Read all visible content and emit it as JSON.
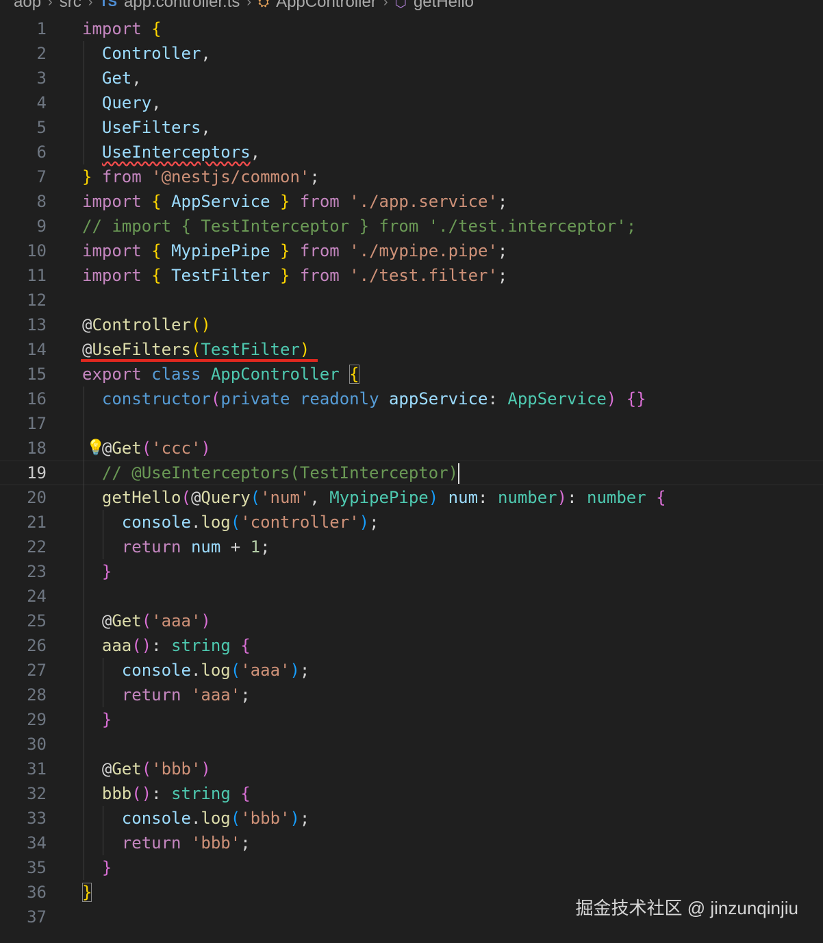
{
  "breadcrumb": {
    "items": [
      "aop",
      "src",
      "app.controller.ts",
      "AppController",
      "getHello"
    ],
    "ts_icon_label": "TS"
  },
  "editor": {
    "current_line": 19,
    "lines": [
      {
        "n": "1",
        "tokens": [
          [
            "import",
            "kw"
          ],
          [
            " ",
            "def"
          ],
          [
            "{",
            "b1"
          ]
        ]
      },
      {
        "n": "2",
        "tokens": [
          [
            "  Controller",
            "var"
          ],
          [
            ",",
            "def"
          ]
        ]
      },
      {
        "n": "3",
        "tokens": [
          [
            "  Get",
            "var"
          ],
          [
            ",",
            "def"
          ]
        ]
      },
      {
        "n": "4",
        "tokens": [
          [
            "  Query",
            "var"
          ],
          [
            ",",
            "def"
          ]
        ]
      },
      {
        "n": "5",
        "tokens": [
          [
            "  UseFilters",
            "var"
          ],
          [
            ",",
            "def"
          ]
        ]
      },
      {
        "n": "6",
        "tokens": [
          [
            "  ",
            "def"
          ],
          [
            "UseInterceptors",
            "var-squiggle"
          ],
          [
            ",",
            "def"
          ]
        ]
      },
      {
        "n": "7",
        "tokens": [
          [
            "}",
            "b1"
          ],
          [
            " ",
            "def"
          ],
          [
            "from",
            "kw"
          ],
          [
            " ",
            "def"
          ],
          [
            "'@nestjs/common'",
            "str"
          ],
          [
            ";",
            "def"
          ]
        ]
      },
      {
        "n": "8",
        "tokens": [
          [
            "import",
            "kw"
          ],
          [
            " ",
            "def"
          ],
          [
            "{",
            "b1"
          ],
          [
            " ",
            "def"
          ],
          [
            "AppService",
            "var"
          ],
          [
            " ",
            "def"
          ],
          [
            "}",
            "b1"
          ],
          [
            " ",
            "def"
          ],
          [
            "from",
            "kw"
          ],
          [
            " ",
            "def"
          ],
          [
            "'./app.service'",
            "str"
          ],
          [
            ";",
            "def"
          ]
        ]
      },
      {
        "n": "9",
        "tokens": [
          [
            "// import { TestInterceptor } from './test.interceptor';",
            "cmt"
          ]
        ]
      },
      {
        "n": "10",
        "tokens": [
          [
            "import",
            "kw"
          ],
          [
            " ",
            "def"
          ],
          [
            "{",
            "b1"
          ],
          [
            " ",
            "def"
          ],
          [
            "MypipePipe",
            "var"
          ],
          [
            " ",
            "def"
          ],
          [
            "}",
            "b1"
          ],
          [
            " ",
            "def"
          ],
          [
            "from",
            "kw"
          ],
          [
            " ",
            "def"
          ],
          [
            "'./mypipe.pipe'",
            "str"
          ],
          [
            ";",
            "def"
          ]
        ]
      },
      {
        "n": "11",
        "tokens": [
          [
            "import",
            "kw"
          ],
          [
            " ",
            "def"
          ],
          [
            "{",
            "b1"
          ],
          [
            " ",
            "def"
          ],
          [
            "TestFilter",
            "var"
          ],
          [
            " ",
            "def"
          ],
          [
            "}",
            "b1"
          ],
          [
            " ",
            "def"
          ],
          [
            "from",
            "kw"
          ],
          [
            " ",
            "def"
          ],
          [
            "'./test.filter'",
            "str"
          ],
          [
            ";",
            "def"
          ]
        ]
      },
      {
        "n": "12",
        "tokens": []
      },
      {
        "n": "13",
        "tokens": [
          [
            "@",
            "def"
          ],
          [
            "Controller",
            "fn"
          ],
          [
            "(",
            "b1"
          ],
          [
            ")",
            "b1"
          ]
        ]
      },
      {
        "n": "14",
        "tokens": [
          [
            "@",
            "def"
          ],
          [
            "UseFilters",
            "fn"
          ],
          [
            "(",
            "b1"
          ],
          [
            "TestFilter",
            "cls"
          ],
          [
            ")",
            "b1"
          ]
        ]
      },
      {
        "n": "15",
        "tokens": [
          [
            "export",
            "kw"
          ],
          [
            " ",
            "def"
          ],
          [
            "class",
            "key"
          ],
          [
            " ",
            "def"
          ],
          [
            "AppController",
            "cls"
          ],
          [
            " ",
            "def"
          ],
          [
            "{",
            "b1-match"
          ]
        ]
      },
      {
        "n": "16",
        "tokens": [
          [
            "  ",
            "def"
          ],
          [
            "constructor",
            "key"
          ],
          [
            "(",
            "b2"
          ],
          [
            "private",
            "key"
          ],
          [
            " ",
            "def"
          ],
          [
            "readonly",
            "key"
          ],
          [
            " ",
            "def"
          ],
          [
            "appService",
            "var"
          ],
          [
            ": ",
            "def"
          ],
          [
            "AppService",
            "cls"
          ],
          [
            ")",
            "b2"
          ],
          [
            " ",
            "def"
          ],
          [
            "{}",
            "b2"
          ]
        ]
      },
      {
        "n": "17",
        "tokens": []
      },
      {
        "n": "18",
        "tokens": [
          [
            "  ",
            "def"
          ],
          [
            "@",
            "def"
          ],
          [
            "Get",
            "fn"
          ],
          [
            "(",
            "b2"
          ],
          [
            "'ccc'",
            "str"
          ],
          [
            ")",
            "b2"
          ]
        ]
      },
      {
        "n": "19",
        "tokens": [
          [
            "  // @UseInterceptors(TestInterceptor)",
            "cmt"
          ]
        ]
      },
      {
        "n": "20",
        "tokens": [
          [
            "  ",
            "def"
          ],
          [
            "getHello",
            "fn"
          ],
          [
            "(",
            "b2"
          ],
          [
            "@",
            "def"
          ],
          [
            "Query",
            "fn"
          ],
          [
            "(",
            "b3"
          ],
          [
            "'num'",
            "str"
          ],
          [
            ", ",
            "def"
          ],
          [
            "MypipePipe",
            "cls"
          ],
          [
            ")",
            "b3"
          ],
          [
            " ",
            "def"
          ],
          [
            "num",
            "var"
          ],
          [
            ": ",
            "def"
          ],
          [
            "number",
            "cls"
          ],
          [
            ")",
            "b2"
          ],
          [
            ": ",
            "def"
          ],
          [
            "number",
            "cls"
          ],
          [
            " ",
            "def"
          ],
          [
            "{",
            "b2"
          ]
        ]
      },
      {
        "n": "21",
        "tokens": [
          [
            "    ",
            "def"
          ],
          [
            "console",
            "var"
          ],
          [
            ".",
            "def"
          ],
          [
            "log",
            "fn"
          ],
          [
            "(",
            "b3"
          ],
          [
            "'controller'",
            "str"
          ],
          [
            ")",
            "b3"
          ],
          [
            ";",
            "def"
          ]
        ]
      },
      {
        "n": "22",
        "tokens": [
          [
            "    ",
            "def"
          ],
          [
            "return",
            "kw"
          ],
          [
            " ",
            "def"
          ],
          [
            "num",
            "var"
          ],
          [
            " + ",
            "def"
          ],
          [
            "1",
            "num"
          ],
          [
            ";",
            "def"
          ]
        ]
      },
      {
        "n": "23",
        "tokens": [
          [
            "  ",
            "def"
          ],
          [
            "}",
            "b2"
          ]
        ]
      },
      {
        "n": "24",
        "tokens": []
      },
      {
        "n": "25",
        "tokens": [
          [
            "  ",
            "def"
          ],
          [
            "@",
            "def"
          ],
          [
            "Get",
            "fn"
          ],
          [
            "(",
            "b2"
          ],
          [
            "'aaa'",
            "str"
          ],
          [
            ")",
            "b2"
          ]
        ]
      },
      {
        "n": "26",
        "tokens": [
          [
            "  ",
            "def"
          ],
          [
            "aaa",
            "fn"
          ],
          [
            "(",
            "b2"
          ],
          [
            ")",
            "b2"
          ],
          [
            ": ",
            "def"
          ],
          [
            "string",
            "cls"
          ],
          [
            " ",
            "def"
          ],
          [
            "{",
            "b2"
          ]
        ]
      },
      {
        "n": "27",
        "tokens": [
          [
            "    ",
            "def"
          ],
          [
            "console",
            "var"
          ],
          [
            ".",
            "def"
          ],
          [
            "log",
            "fn"
          ],
          [
            "(",
            "b3"
          ],
          [
            "'aaa'",
            "str"
          ],
          [
            ")",
            "b3"
          ],
          [
            ";",
            "def"
          ]
        ]
      },
      {
        "n": "28",
        "tokens": [
          [
            "    ",
            "def"
          ],
          [
            "return",
            "kw"
          ],
          [
            " ",
            "def"
          ],
          [
            "'aaa'",
            "str"
          ],
          [
            ";",
            "def"
          ]
        ]
      },
      {
        "n": "29",
        "tokens": [
          [
            "  ",
            "def"
          ],
          [
            "}",
            "b2"
          ]
        ]
      },
      {
        "n": "30",
        "tokens": []
      },
      {
        "n": "31",
        "tokens": [
          [
            "  ",
            "def"
          ],
          [
            "@",
            "def"
          ],
          [
            "Get",
            "fn"
          ],
          [
            "(",
            "b2"
          ],
          [
            "'bbb'",
            "str"
          ],
          [
            ")",
            "b2"
          ]
        ]
      },
      {
        "n": "32",
        "tokens": [
          [
            "  ",
            "def"
          ],
          [
            "bbb",
            "fn"
          ],
          [
            "(",
            "b2"
          ],
          [
            ")",
            "b2"
          ],
          [
            ": ",
            "def"
          ],
          [
            "string",
            "cls"
          ],
          [
            " ",
            "def"
          ],
          [
            "{",
            "b2"
          ]
        ]
      },
      {
        "n": "33",
        "tokens": [
          [
            "    ",
            "def"
          ],
          [
            "console",
            "var"
          ],
          [
            ".",
            "def"
          ],
          [
            "log",
            "fn"
          ],
          [
            "(",
            "b3"
          ],
          [
            "'bbb'",
            "str"
          ],
          [
            ")",
            "b3"
          ],
          [
            ";",
            "def"
          ]
        ]
      },
      {
        "n": "34",
        "tokens": [
          [
            "    ",
            "def"
          ],
          [
            "return",
            "kw"
          ],
          [
            " ",
            "def"
          ],
          [
            "'bbb'",
            "str"
          ],
          [
            ";",
            "def"
          ]
        ]
      },
      {
        "n": "35",
        "tokens": [
          [
            "  ",
            "def"
          ],
          [
            "}",
            "b2"
          ]
        ]
      },
      {
        "n": "36",
        "tokens": [
          [
            "}",
            "b1-match"
          ]
        ]
      },
      {
        "n": "37",
        "tokens": []
      }
    ]
  },
  "lightbulb_icon": "lightbulb-icon",
  "watermark": "掘金技术社区 @ jinzunqinjiu",
  "colors": {
    "background": "#1f1f1f",
    "keyword": "#c586c0",
    "class": "#4ec9b0",
    "variable": "#9cdcfe",
    "function": "#dcdcaa",
    "string": "#ce9178",
    "comment": "#6a9955",
    "annotation_underline": "#e0281f"
  }
}
